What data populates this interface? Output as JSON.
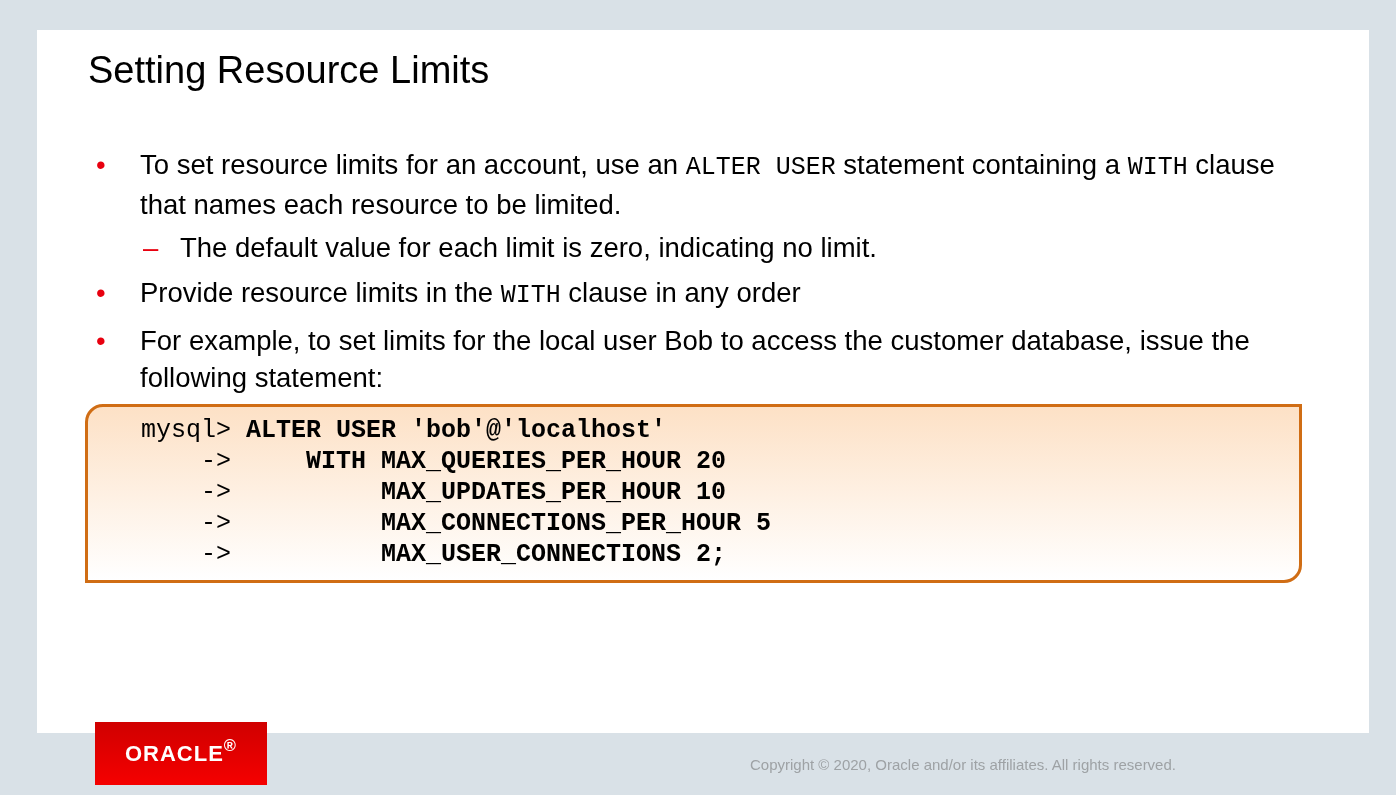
{
  "slide": {
    "title": "Setting Resource Limits",
    "bullets": [
      {
        "marker": "•",
        "segments": [
          {
            "kind": "text",
            "text": "To set resource limits for an account, use an "
          },
          {
            "kind": "code",
            "text": "ALTER USER"
          },
          {
            "kind": "text",
            "text": " statement containing a "
          },
          {
            "kind": "code",
            "text": "WITH"
          },
          {
            "kind": "text",
            "text": " clause that names each resource to be limited."
          }
        ],
        "children": [
          {
            "marker": "–",
            "segments": [
              {
                "kind": "text",
                "text": "The default value for each limit is zero, indicating no limit."
              }
            ]
          }
        ]
      },
      {
        "marker": "•",
        "segments": [
          {
            "kind": "text",
            "text": "Provide resource limits in the "
          },
          {
            "kind": "code",
            "text": "WITH"
          },
          {
            "kind": "text",
            "text": " clause in any order"
          }
        ]
      },
      {
        "marker": "•",
        "segments": [
          {
            "kind": "text",
            "text": "For example, to set limits for the local user Bob to access the customer database, issue the following statement:"
          }
        ]
      }
    ],
    "code_lines": [
      "mysql> **ALTER USER 'bob'@'localhost'**",
      "    ->     **WITH MAX_QUERIES_PER_HOUR 20**",
      "    ->          **MAX_UPDATES_PER_HOUR 10**",
      "    ->          **MAX_CONNECTIONS_PER_HOUR 5**",
      "    ->          **MAX_USER_CONNECTIONS 2;**"
    ]
  },
  "footer": {
    "logo": "ORACLE$^{®}$",
    "copyright": "Copyright © 2020, Oracle and/or its affiliates. All rights reserved."
  }
}
